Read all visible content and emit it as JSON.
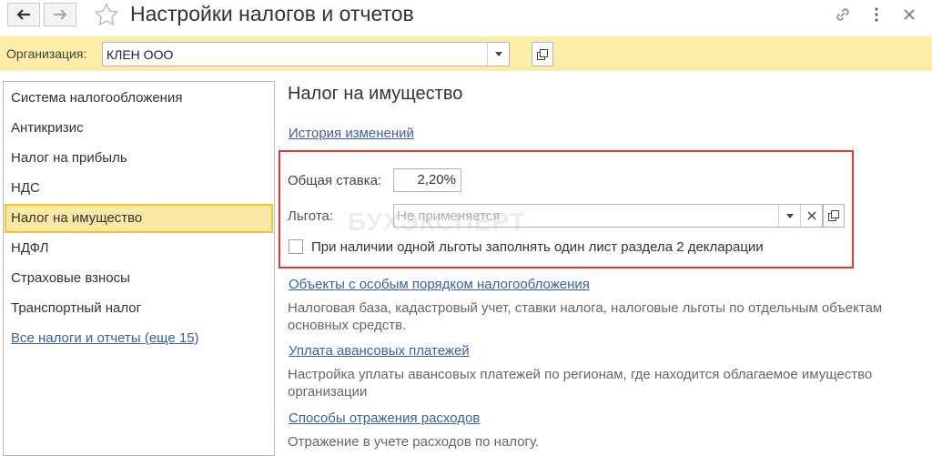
{
  "window": {
    "title": "Настройки налогов и отчетов"
  },
  "org": {
    "label": "Организация:",
    "value": "КЛЕН ООО"
  },
  "sidebar": {
    "items": [
      {
        "label": "Система налогообложения"
      },
      {
        "label": "Антикризис"
      },
      {
        "label": "Налог на прибыль"
      },
      {
        "label": "НДС"
      },
      {
        "label": "Налог на имущество",
        "active": true
      },
      {
        "label": "НДФЛ"
      },
      {
        "label": "Страховые взносы"
      },
      {
        "label": "Транспортный налог"
      }
    ],
    "all_link": "Все налоги и отчеты (еще 15)"
  },
  "main": {
    "section_title": "Налог на имущество",
    "history_link": "История изменений",
    "rate_label": "Общая ставка:",
    "rate_value": "2,20%",
    "benefit_label": "Льгота:",
    "benefit_placeholder": "Не применяется",
    "checkbox_label": "При наличии одной льготы заполнять один лист раздела 2 декларации",
    "checkbox_checked": false,
    "sections": [
      {
        "link": "Объекты с особым порядком налогообложения",
        "desc_line1": "Налоговая база, кадастровый учет, ставки налога, налоговые льготы по отдельным объектам",
        "desc_line2": "основных средств."
      },
      {
        "link": "Уплата авансовых платежей",
        "desc_line1": "Настройка уплаты авансовых платежей по регионам, где находится облагаемое имущество",
        "desc_line2": "организации"
      },
      {
        "link": "Способы отражения расходов",
        "desc_line1": "Отражение в учете расходов по налогу."
      }
    ],
    "watermark": "БУХЭКСПЕРТ"
  },
  "colors": {
    "org_bar": "#fbeda8",
    "active_item_bg": "#fbe9a3",
    "active_item_border": "#f2c335",
    "link": "#3a5fa6",
    "highlight_box": "#e53935"
  }
}
